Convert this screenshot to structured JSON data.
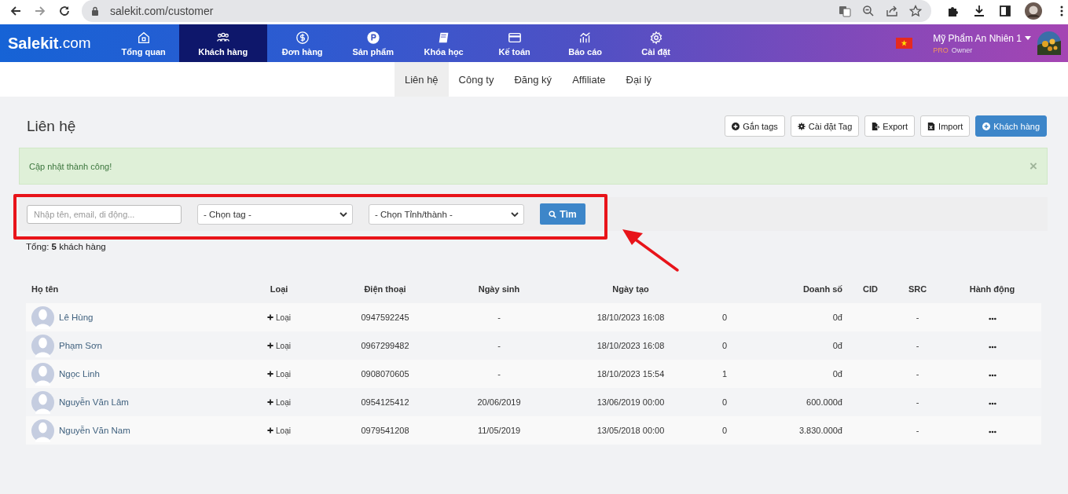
{
  "browser": {
    "url": "salekit.com/customer"
  },
  "header": {
    "logo_main": "Salekit",
    "logo_suffix": ".com",
    "nav": [
      {
        "label": "Tổng quan",
        "selected": false
      },
      {
        "label": "Khách hàng",
        "selected": true
      },
      {
        "label": "Đơn hàng",
        "selected": false
      },
      {
        "label": "Sản phẩm",
        "selected": false
      },
      {
        "label": "Khóa học",
        "selected": false
      },
      {
        "label": "Kế toán",
        "selected": false
      },
      {
        "label": "Báo cáo",
        "selected": false
      },
      {
        "label": "Cài đặt",
        "selected": false
      }
    ],
    "user": {
      "name": "Mỹ Phẩm An Nhiên 1",
      "plan": "PRO",
      "role": "Owner"
    }
  },
  "subnav": [
    {
      "label": "Liên hệ",
      "selected": true
    },
    {
      "label": "Công ty",
      "selected": false
    },
    {
      "label": "Đăng ký",
      "selected": false
    },
    {
      "label": "Affiliate",
      "selected": false
    },
    {
      "label": "Đại lý",
      "selected": false
    }
  ],
  "page_title": "Liên hệ",
  "actions": [
    {
      "label": "Gắn tags",
      "primary": false
    },
    {
      "label": "Cài đặt Tag",
      "primary": false
    },
    {
      "label": "Export",
      "primary": false
    },
    {
      "label": "Import",
      "primary": false
    },
    {
      "label": "Khách hàng",
      "primary": true
    }
  ],
  "alert": {
    "message": "Cập nhật thành công!",
    "close": "×"
  },
  "filter": {
    "search_placeholder": "Nhập tên, email, di động...",
    "tag_select": "- Chọn tag -",
    "city_select": "- Chọn Tỉnh/thành -",
    "button": "Tìm"
  },
  "total": "Tổng: **5** khách hàng",
  "table": {
    "columns": [
      "Họ tên",
      "Loại",
      "Điện thoại",
      "Ngày sinh",
      "Ngày tạo",
      "Doanh số",
      "CID",
      "SRC",
      "Hành động"
    ],
    "rows": [
      {
        "name": "Lê Hùng",
        "type": "Loại",
        "phone": "0947592245",
        "birthday": "-",
        "created": "18/10/2023 16:08",
        "column_6": "0",
        "revenue": "0đ",
        "src": "-"
      },
      {
        "name": "Phạm Sơn",
        "type": "Loại",
        "phone": "0967299482",
        "birthday": "-",
        "created": "18/10/2023 16:08",
        "column_6": "0",
        "revenue": "0đ",
        "src": "-"
      },
      {
        "name": "Ngọc Linh",
        "type": "Loại",
        "phone": "0908070605",
        "birthday": "-",
        "created": "18/10/2023 15:54",
        "column_6": "1",
        "revenue": "0đ",
        "src": "-"
      },
      {
        "name": "Nguyễn Văn Lâm",
        "type": "Loại",
        "phone": "0954125412",
        "birthday": "20/06/2019",
        "created": "13/06/2019 00:00",
        "column_6": "0",
        "revenue": "600.000đ",
        "src": "-"
      },
      {
        "name": "Nguyễn Văn Nam",
        "type": "Loại",
        "phone": "0979541208",
        "birthday": "11/05/2019",
        "created": "13/05/2018 00:00",
        "column_6": "0",
        "revenue": "3.830.000đ",
        "src": "-"
      }
    ]
  }
}
